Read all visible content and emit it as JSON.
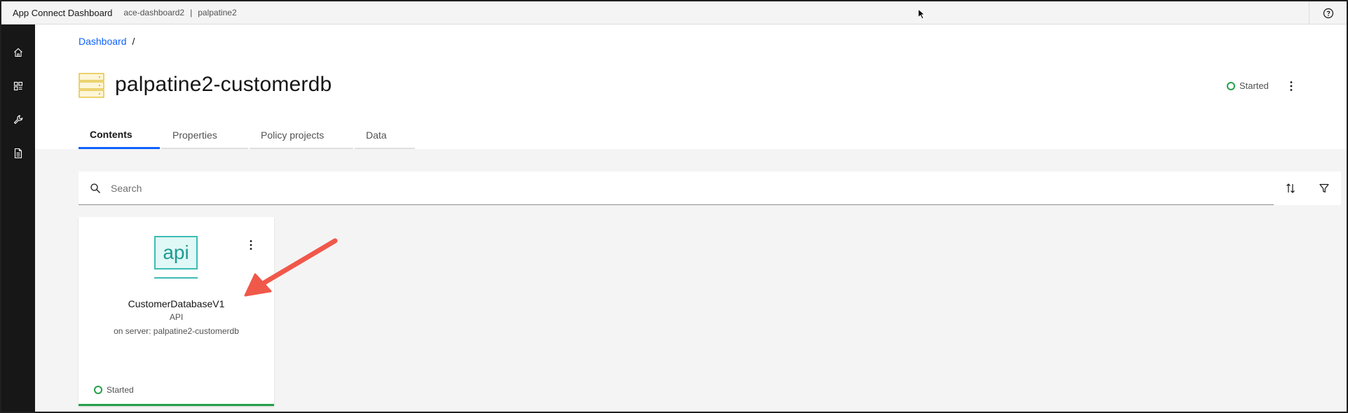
{
  "header": {
    "app_title": "App Connect Dashboard",
    "instance_name": "ace-dashboard2",
    "separator": "|",
    "namespace": "palpatine2",
    "help_icon": "help-icon"
  },
  "sidenav": {
    "items": [
      {
        "icon": "home-icon"
      },
      {
        "icon": "catalog-icon"
      },
      {
        "icon": "wrench-icon"
      },
      {
        "icon": "document-icon"
      }
    ]
  },
  "breadcrumb": {
    "items": [
      "Dashboard"
    ],
    "separator": "/"
  },
  "page": {
    "title": "palpatine2-customerdb",
    "status": "Started",
    "status_color": "#24a148"
  },
  "tabs": [
    {
      "label": "Contents",
      "active": true
    },
    {
      "label": "Properties",
      "active": false
    },
    {
      "label": "Policy projects",
      "active": false
    },
    {
      "label": "Data",
      "active": false
    }
  ],
  "search": {
    "placeholder": "Search",
    "value": ""
  },
  "cards": [
    {
      "icon_text": "api",
      "name": "CustomerDatabaseV1",
      "type": "API",
      "server": "on server: palpatine2-customerdb",
      "status": "Started"
    }
  ],
  "colors": {
    "accent": "#0f62fe",
    "success": "#24a148",
    "api_teal": "#3dbcb4",
    "server_icon": "#f1c21b",
    "annotation_arrow": "#f0584a",
    "sidenav_bg": "#171717"
  }
}
